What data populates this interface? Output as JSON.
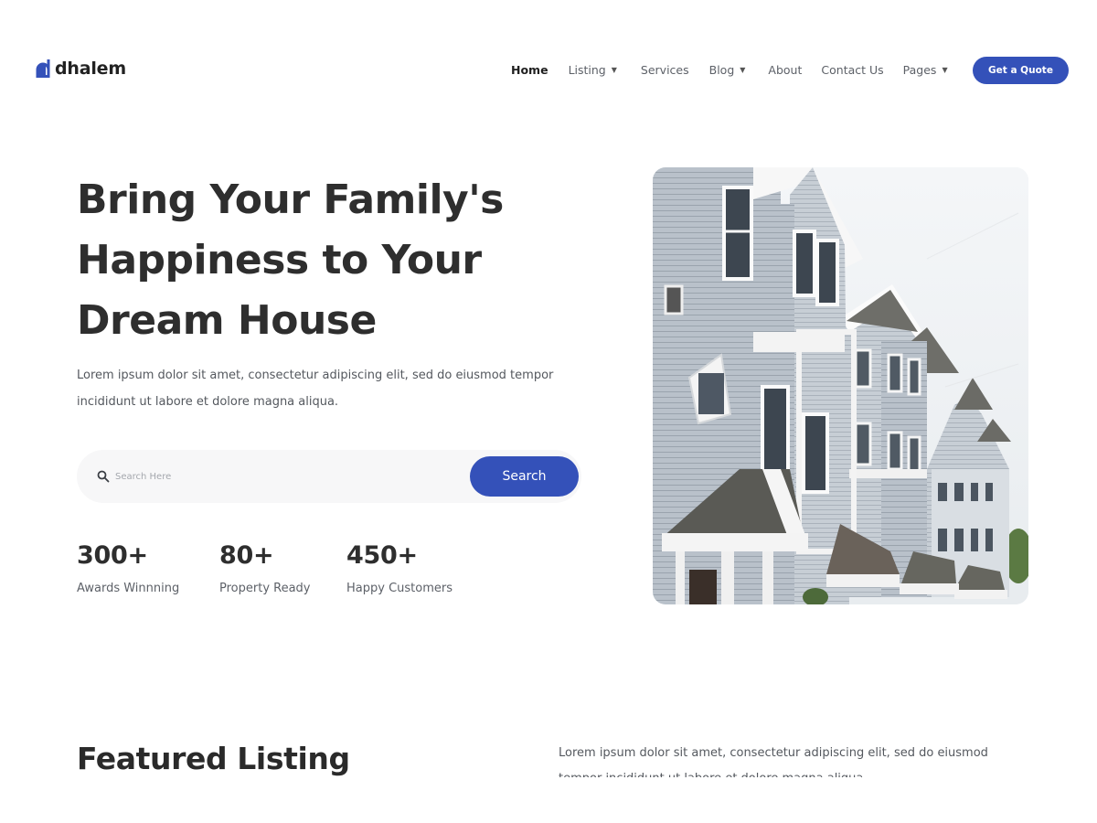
{
  "brand": {
    "name": "dhalem",
    "accent": "#3451b9",
    "logo_icon": "house-d-logo-icon"
  },
  "nav": {
    "items": [
      {
        "label": "Home",
        "active": true,
        "dropdown": false
      },
      {
        "label": "Listing",
        "active": false,
        "dropdown": true
      },
      {
        "label": "Services",
        "active": false,
        "dropdown": false
      },
      {
        "label": "Blog",
        "active": false,
        "dropdown": true
      },
      {
        "label": "About",
        "active": false,
        "dropdown": false
      },
      {
        "label": "Contact Us",
        "active": false,
        "dropdown": false
      },
      {
        "label": "Pages",
        "active": false,
        "dropdown": true
      }
    ],
    "cta_label": "Get a Quote"
  },
  "hero": {
    "title_lines": [
      "Bring Your Family's",
      "Happiness to Your",
      "Dream House"
    ],
    "desc_lines": [
      "Lorem ipsum dolor sit amet, consectetur adipiscing elit, sed do eiusmod tempor",
      "incididunt ut labore et dolore magna aliqua."
    ],
    "search": {
      "placeholder": "Search Here",
      "value": "",
      "button_label": "Search",
      "icon": "search-icon"
    },
    "stats": [
      {
        "value": "300+",
        "label": "Awards Winnning"
      },
      {
        "value": "80+",
        "label": "Property Ready"
      },
      {
        "value": "450+",
        "label": "Happy Customers"
      }
    ],
    "image_subject": "row of townhouses"
  },
  "featured": {
    "title": "Featured Listing",
    "desc_lines": [
      "Lorem ipsum dolor sit amet, consectetur adipiscing elit, sed do eiusmod",
      "tempor incididunt ut labore et dolore magna aliqua."
    ]
  }
}
